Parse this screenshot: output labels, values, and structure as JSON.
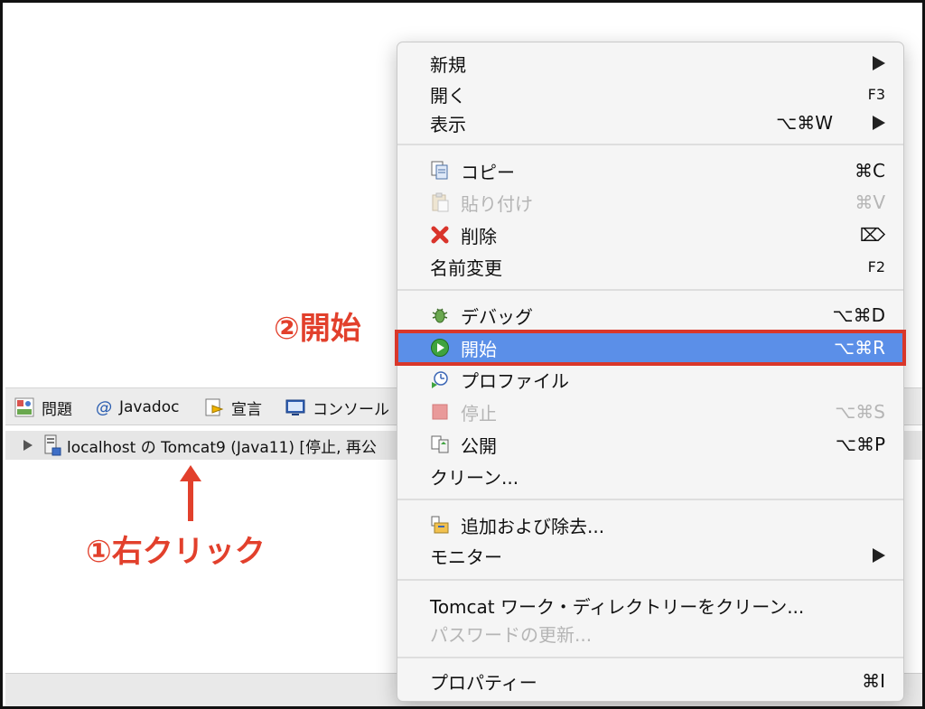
{
  "tabs": [
    {
      "label": "問題",
      "icon": "problems-icon"
    },
    {
      "label": "Javadoc",
      "icon": "at-icon"
    },
    {
      "label": "宣言",
      "icon": "declaration-icon"
    },
    {
      "label": "コンソール",
      "icon": "console-icon"
    }
  ],
  "server": {
    "label": "localhost の Tomcat9 (Java11)  [停止, 再公",
    "icon": "server-icon"
  },
  "annotations": {
    "start": "②開始",
    "right_click": "①右クリック",
    "color": "#e2402c"
  },
  "menu": {
    "new": {
      "label": "新規"
    },
    "open": {
      "label": "開く",
      "shortcut": "F3"
    },
    "show": {
      "label": "表示",
      "shortcut": "⌥⌘W"
    },
    "copy": {
      "label": "コピー",
      "shortcut": "⌘C",
      "icon": "copy-icon"
    },
    "paste": {
      "label": "貼り付け",
      "shortcut": "⌘V",
      "icon": "paste-icon",
      "disabled": true
    },
    "delete": {
      "label": "削除",
      "shortcut": "⌦",
      "icon": "delete-x-icon"
    },
    "rename": {
      "label": "名前変更",
      "shortcut": "F2"
    },
    "debug": {
      "label": "デバッグ",
      "shortcut": "⌥⌘D",
      "icon": "debug-bug-icon"
    },
    "start": {
      "label": "開始",
      "shortcut": "⌥⌘R",
      "icon": "play-icon",
      "highlighted": true
    },
    "profile": {
      "label": "プロファイル",
      "icon": "profile-icon"
    },
    "stop": {
      "label": "停止",
      "shortcut": "⌥⌘S",
      "icon": "stop-icon",
      "disabled": true
    },
    "publish": {
      "label": "公開",
      "shortcut": "⌥⌘P",
      "icon": "publish-icon"
    },
    "clean": {
      "label": "クリーン..."
    },
    "add_remove": {
      "label": "追加および除去...",
      "icon": "add-remove-icon"
    },
    "monitor": {
      "label": "モニター"
    },
    "clean_work_dir": {
      "label": "Tomcat ワーク・ディレクトリーをクリーン..."
    },
    "update_password": {
      "label": "パスワードの更新...",
      "disabled": true
    },
    "properties": {
      "label": "プロパティー",
      "shortcut": "⌘I"
    }
  },
  "colors": {
    "highlight": "#5b8fe8",
    "highlight_border": "#d9372a",
    "disabled_text": "#b5b5b5"
  }
}
